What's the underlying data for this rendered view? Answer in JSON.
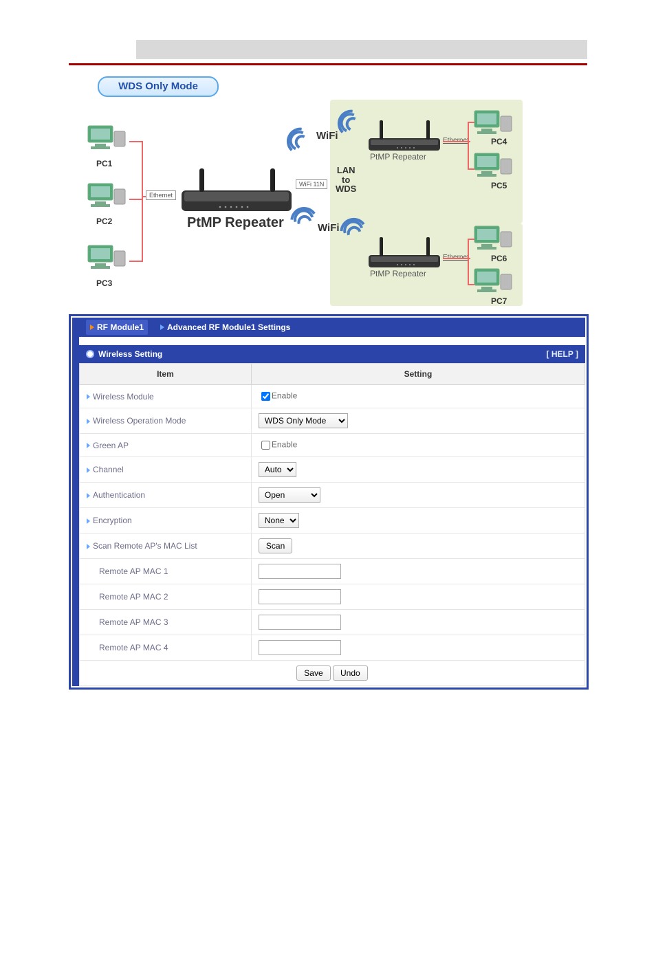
{
  "badge": "WDS Only Mode",
  "diagram": {
    "pc1": "PC1",
    "pc2": "PC2",
    "pc3": "PC3",
    "pc4": "PC4",
    "pc5": "PC5",
    "pc6": "PC6",
    "pc7": "PC7",
    "ethernet": "Ethernet",
    "wifi11n": "WiFi 11N",
    "wifi": "WiFi",
    "lan_to_wds_1": "LAN",
    "lan_to_wds_2": "to",
    "lan_to_wds_3": "WDS",
    "ptmp_main": "PtMP Repeater",
    "ptmp_sub": "PtMP Repeater"
  },
  "tabs": {
    "rf": "RF Module1",
    "adv": "Advanced RF Module1 Settings"
  },
  "panel": {
    "title": "Wireless Setting",
    "help": "[ HELP ]",
    "col_item": "Item",
    "col_setting": "Setting"
  },
  "rows": {
    "wireless_module": "Wireless Module",
    "wireless_module_opt": "Enable",
    "wireless_op_mode": "Wireless Operation Mode",
    "wireless_op_mode_val": "WDS Only Mode",
    "green_ap": "Green AP",
    "green_ap_opt": "Enable",
    "channel": "Channel",
    "channel_val": "Auto",
    "auth": "Authentication",
    "auth_val": "Open",
    "enc": "Encryption",
    "enc_val": "None",
    "scan": "Scan Remote AP's MAC List",
    "scan_btn": "Scan",
    "mac1": "Remote AP MAC 1",
    "mac2": "Remote AP MAC 2",
    "mac3": "Remote AP MAC 3",
    "mac4": "Remote AP MAC 4"
  },
  "buttons": {
    "save": "Save",
    "undo": "Undo"
  }
}
